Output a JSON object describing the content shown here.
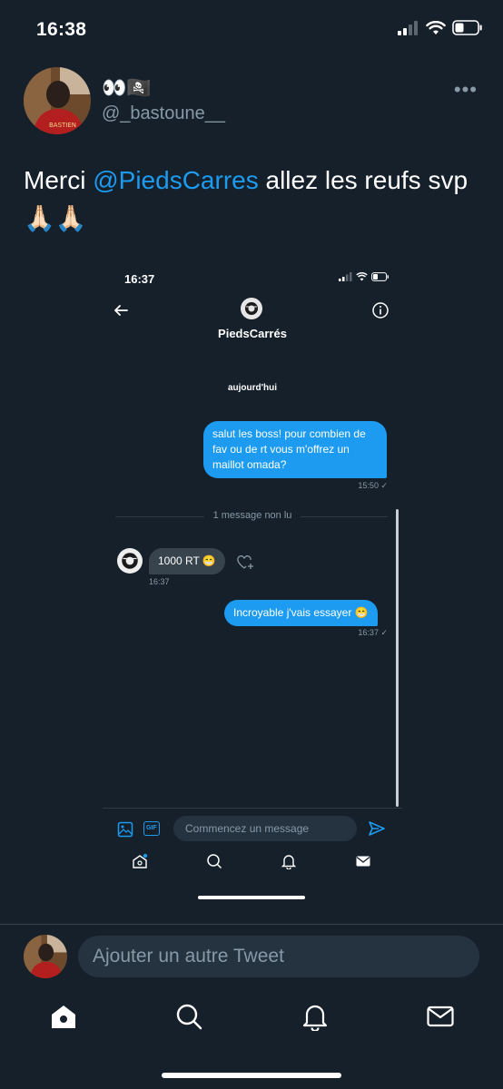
{
  "status_bar": {
    "time": "16:38"
  },
  "tweet": {
    "author_name": "👀🏴‍☠️",
    "author_handle": "@_bastoune__",
    "text_before": "Merci ",
    "mention": "@PiedsCarres",
    "text_after": " allez les reufs svp 🙏🏻🙏🏻"
  },
  "embedded_screenshot": {
    "time": "16:37",
    "contact_name": "PiedsCarrés",
    "date_label": "aujourd'hui",
    "messages": [
      {
        "text": "salut les boss! pour combien de fav ou de rt vous m'offrez un maillot omada?",
        "time": "15:50 ✓"
      },
      {
        "text": "1000 RT 😁",
        "time": "16:37"
      },
      {
        "text": "Incroyable j'vais essayer 😁",
        "time": "16:37 ✓"
      }
    ],
    "unread_label": "1 message non lu",
    "composer_placeholder": "Commencez un message",
    "gif_label": "GIF"
  },
  "reply": {
    "placeholder": "Ajouter un autre Tweet"
  },
  "colors": {
    "background": "#15202b",
    "accent": "#1d9bf0",
    "bubble_incoming": "#38444d"
  },
  "icons": [
    "more-icon",
    "back-arrow-icon",
    "info-icon",
    "heart-plus-icon",
    "image-icon",
    "gif-icon",
    "send-icon",
    "home-icon",
    "search-icon",
    "bell-icon",
    "mail-icon"
  ]
}
